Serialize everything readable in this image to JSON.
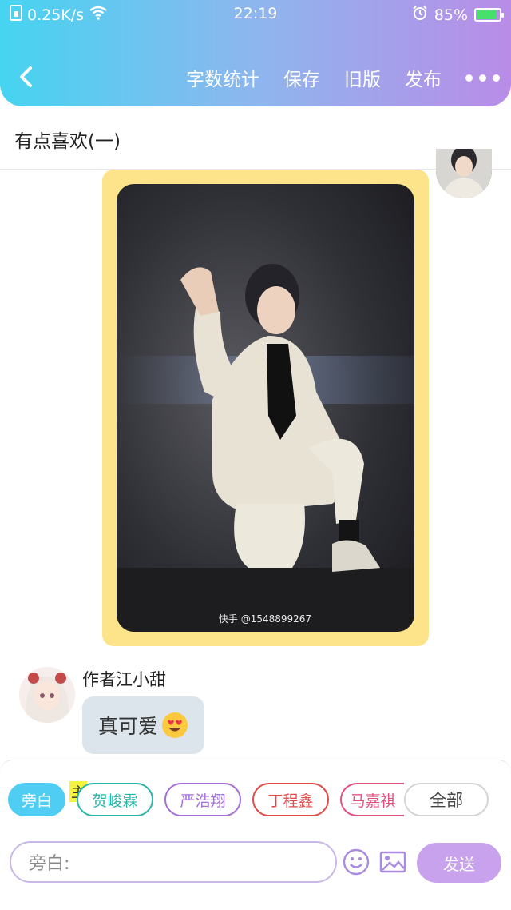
{
  "status_bar": {
    "net_speed": "0.25K/s",
    "time": "22:19",
    "battery": "85%",
    "battery_level": 0.85,
    "icons": [
      "sim-icon",
      "wifi-icon",
      "alarm-icon",
      "battery-icon"
    ]
  },
  "nav": {
    "back_icon": "chevron-left-icon",
    "actions": [
      "字数统计",
      "保存",
      "旧版",
      "发布"
    ],
    "more_icon": "more-dots-icon"
  },
  "document": {
    "title": "有点喜欢(一)"
  },
  "photo": {
    "watermark": "快手 @1548899267",
    "card_color": "#fde48a"
  },
  "message": {
    "author": "作者江小甜",
    "text": "真可爱",
    "emoji": "heart-eyes-emoji"
  },
  "roles": {
    "current": "旁白",
    "main_tag": "主",
    "items": [
      {
        "label": "贺峻霖",
        "color": "#28b6a6"
      },
      {
        "label": "严浩翔",
        "color": "#a36ed8"
      },
      {
        "label": "丁程鑫",
        "color": "#e24a4a"
      },
      {
        "label": "马嘉祺",
        "color": "#e2507e"
      }
    ],
    "all_label": "全部"
  },
  "composer": {
    "placeholder": "旁白:",
    "send_label": "发送",
    "emoji_icon": "smiley-icon",
    "image_icon": "image-icon"
  },
  "colors": {
    "gradient_start": "#45d4f1",
    "gradient_end": "#b98ce7",
    "accent": "#4fcdf3",
    "send_button": "#c8a2ec"
  }
}
